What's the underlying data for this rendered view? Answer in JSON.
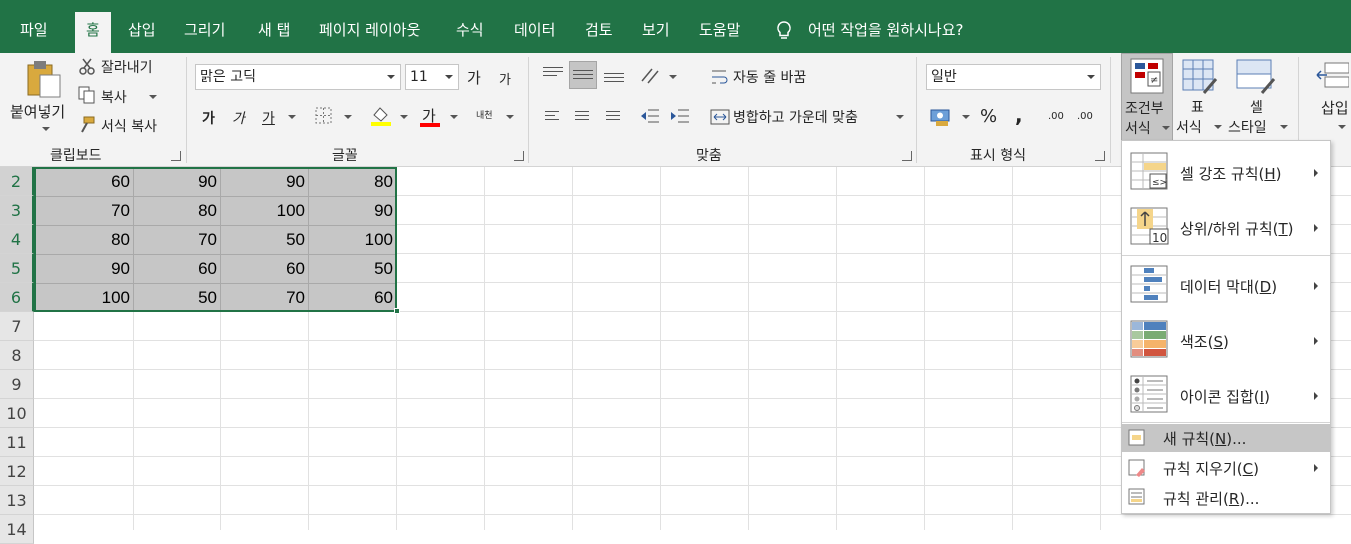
{
  "tabs": [
    "파일",
    "홈",
    "삽입",
    "그리기",
    "새 탭",
    "페이지 레이아웃",
    "수식",
    "데이터",
    "검토",
    "보기",
    "도움말"
  ],
  "tell_me": "어떤 작업을 원하시나요?",
  "clipboard": {
    "paste": "붙여넣기",
    "cut": "잘라내기",
    "copy": "복사",
    "format_painter": "서식 복사",
    "group": "클립보드"
  },
  "font": {
    "name": "맑은 고딕",
    "size": "11",
    "grow": "가",
    "shrink": "가",
    "bold": "가",
    "italic": "가",
    "underline": "가",
    "font_color": "가",
    "phonetic": "내천",
    "group": "글꼴"
  },
  "alignment": {
    "wrap": "자동 줄 바꿈",
    "merge": "병합하고 가운데 맞춤",
    "group": "맞춤"
  },
  "number": {
    "format": "일반",
    "percent": "%",
    "comma": ",",
    "inc_decimal": ".00",
    "dec_decimal": ".00",
    "group": "표시 형식"
  },
  "styles": {
    "conditional": "조건부",
    "conditional2": "서식",
    "table": "표",
    "table2": "서식",
    "cell": "셀",
    "cell2": "스타일"
  },
  "cells": {
    "insert": "삽입"
  },
  "rows": [
    "2",
    "3",
    "4",
    "5",
    "6",
    "7",
    "8",
    "9",
    "10",
    "11",
    "12",
    "13",
    "14"
  ],
  "grid": [
    [
      "60",
      "90",
      "90",
      "80"
    ],
    [
      "70",
      "80",
      "100",
      "90"
    ],
    [
      "80",
      "70",
      "50",
      "100"
    ],
    [
      "90",
      "60",
      "60",
      "50"
    ],
    [
      "100",
      "50",
      "70",
      "60"
    ]
  ],
  "menu": {
    "highlight": {
      "text": "셀 강조 규칙(",
      "key": "H",
      "end": ")"
    },
    "topbottom": {
      "text": "상위/하위 규칙(",
      "key": "T",
      "end": ")"
    },
    "databar": {
      "text": "데이터 막대(",
      "key": "D",
      "end": ")"
    },
    "colorscale": {
      "text": "색조(",
      "key": "S",
      "end": ")"
    },
    "iconset": {
      "text": "아이콘 집합(",
      "key": "I",
      "end": ")"
    },
    "newrule": {
      "text": "새 규칙(",
      "key": "N",
      "end": ")..."
    },
    "clearrules": {
      "text": "규칙 지우기(",
      "key": "C",
      "end": ")"
    },
    "managerules": {
      "text": "규칙 관리(",
      "key": "R",
      "end": ")..."
    },
    "topbottom_badge": "10"
  },
  "colors": {
    "accent": "#217346",
    "font_highlight": "#ffff00",
    "font_color": "#ff0000"
  }
}
